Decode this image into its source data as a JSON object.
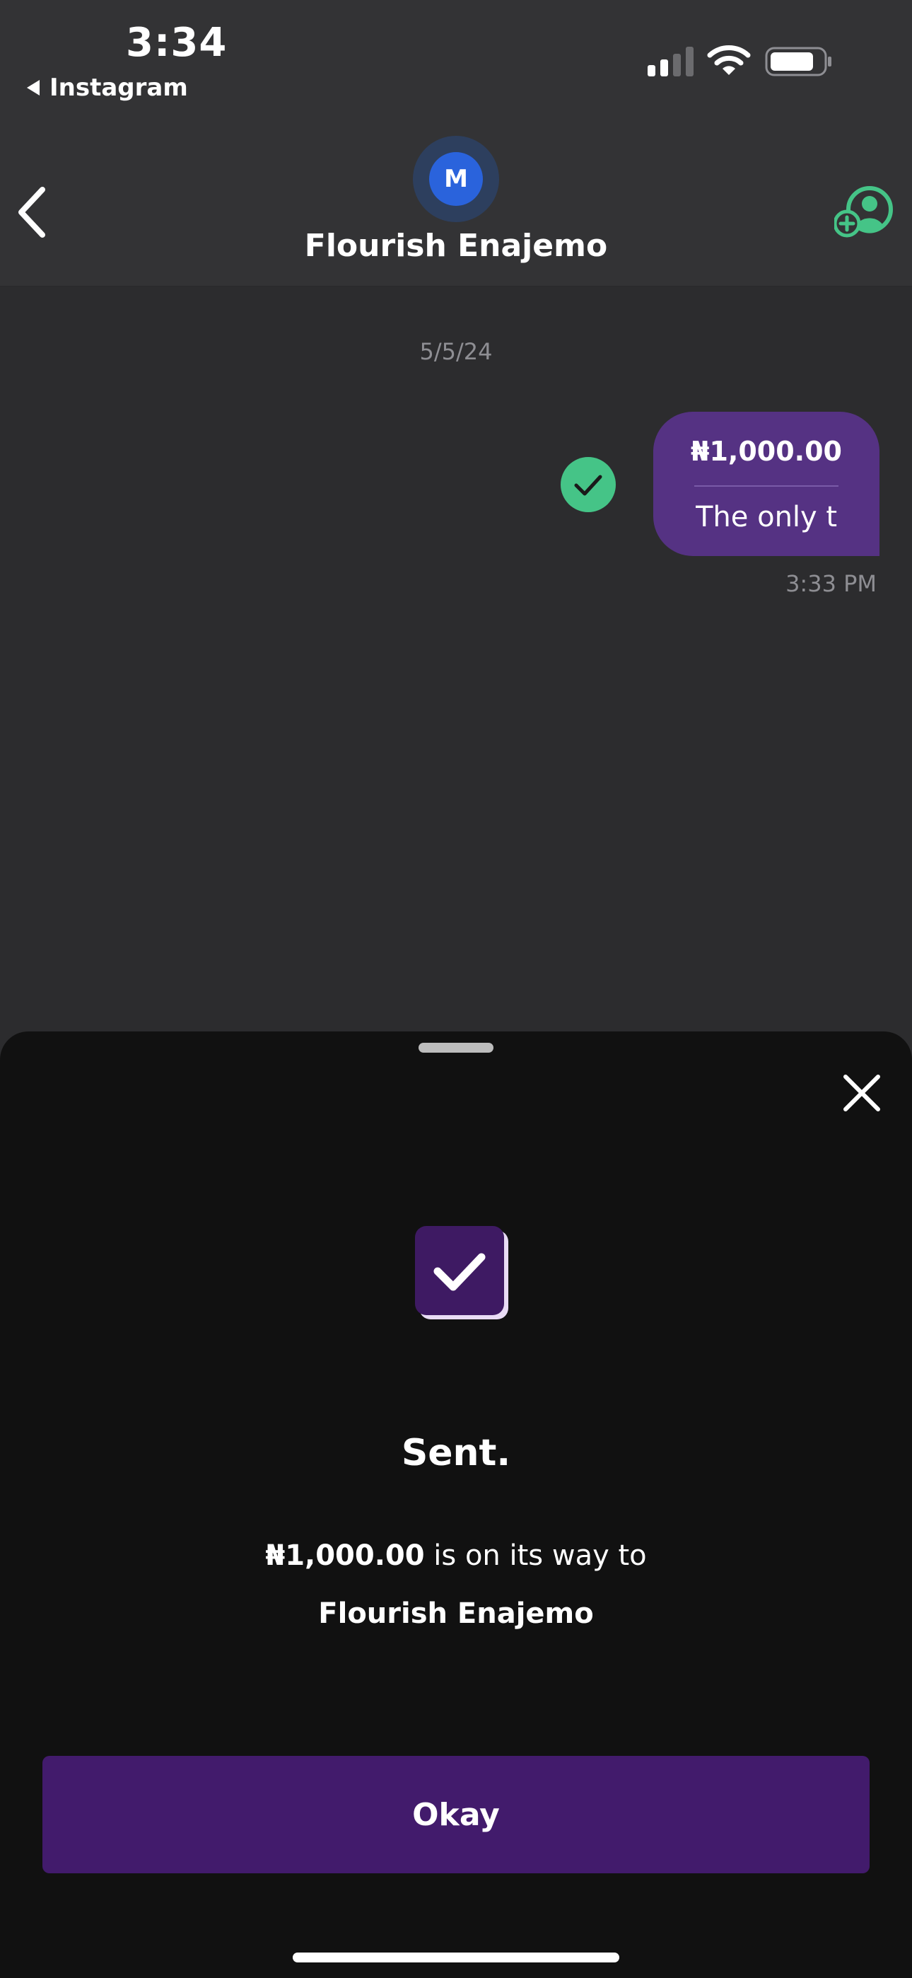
{
  "status_bar": {
    "time": "3:34",
    "back_app": "Instagram",
    "icons": [
      "signal-icon",
      "wifi-icon",
      "battery-icon"
    ]
  },
  "header": {
    "avatar_initial": "M",
    "contact_name": "Flourish Enajemo",
    "icons": [
      "back-chevron-icon",
      "add-user-icon"
    ]
  },
  "chat": {
    "date": "5/5/24",
    "message": {
      "amount": "₦1,000.00",
      "note": "The only t",
      "time": "3:33 PM",
      "status_icon": "check-circle-icon"
    }
  },
  "sheet": {
    "title": "Sent.",
    "amount": "₦1,000.00",
    "message_rest": " is on its way to",
    "recipient": "Flourish Enajemo",
    "button_label": "Okay",
    "icons": [
      "close-icon",
      "sent-check-icon"
    ]
  },
  "colors": {
    "accent_purple": "#421b6c",
    "bubble_purple": "#553283",
    "success_green": "#45c487",
    "background": "#2c2c2e",
    "sheet_background": "#111111"
  }
}
